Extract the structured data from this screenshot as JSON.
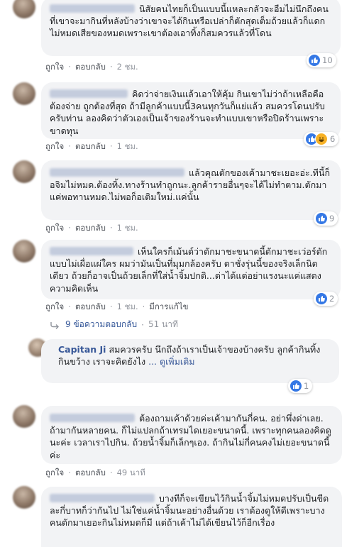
{
  "ui": {
    "like": "ถูกใจ",
    "reply": "ตอบกลับ",
    "dot": "·"
  },
  "comments": [
    {
      "text": "นิสัยคนไทยก็เป็นแบบนี้แหละกลัวจะอืมไม่นึกถึงคนที่เขาจะมากินที่หลังบ้างว่าเขาจะได้กินหรือเปล่าก็ตักสุดเต็มถ้วยแล้วก็แดกไม่หมดเสียของหมดเพราะเขาต้องเอาทิ้งก็สมควรแล้วที่โดน",
      "time": "2 ชม.",
      "reactions": "10"
    },
    {
      "text": "คิดว่าจ่ายเงินแล้วเอาให้คุ้ม กินเขาไม่ว่าถ้าเหลือคือต้องจ่าย ถูกต้องที่สุด ถ้ามีลูกค้าแบบนี้3คนทุกวันก็แย่แล้ว สมควรโดนปรับครับท่าน ลองคิดว่าตัวเองเป็นเจ้าของร้านจะทำแบบเขาหรือปิดร้านเพราะขาดทุน",
      "time": "1 ชม.",
      "reactions": "6"
    },
    {
      "text": "แล้วคุณตักของเค้ามาชะเยอะอ่ะ.ทีนี้ก็อจิมไม่หมด.ต้องทิ้ง.ทางร้านทำถูกนะ.ลูกค้ารายอื่นๆจะได้ไม่ทำตาม.ตักมาแค่พอทานหมด.ไม่พอก็อเติมใหม่.แค่นั้น",
      "time": "1 ชม.",
      "reactions": "9"
    },
    {
      "text": "เห็นใครก็เม้นต์ว่าตักมาชะขนาดนี้ตักมาชะเว่อร์ตักแบบไม่เผื่อแผ่ใคร ผมว่ามันเป็นที่มุมกล้องครับ ตาชั่งรุ่นนี้ของจริงเล็กนิดเดียว ถ้วยก็อาจเป็นถ้วยเล็กที่ใส่น้ำจิ้มปกติ...ด่าได้แต่อย่าแรงนะแค่แสดงความคิดเห็น",
      "time": "1 ชม.",
      "edited": "มีการแก้ไข",
      "reactions": "2"
    },
    {
      "name": "Capitan Ji",
      "text": "สมควรครับ นึกถึงถ้าเราเป็นเจ้าของบ้างครับ ลูกค้ากินทิ้งกินขว้าง เราจะคิดยังไง",
      "more": "... ดูเพิ่มเติม",
      "reactions": "1"
    },
    {
      "text": "ต้องถามเค้าด้วยค่ะเค้ามากันกี่คน. อย่าพึ่งด่าเลย. ถ้ามากันหลายคน. ก็ไม่แปลกถ้าเทรมไดเยอะขนาดนี้. เพราะทุกคนลองคิดดูนะค่ะ เวลาเราไปกิน. ถ้วยน้ำจิ้มก็เล็กๆเอง. ถ้ากินไม่กี่คนคงไม่เยอะขนาดนี้ค่ะ",
      "time": "49 นาที"
    },
    {
      "text": "บางทีก็จะเขียนไว้กินน้ำจิ้มไม่หมดปรับเป็นขีดละกี่บาทก็ว่ากันไป ไม่ใช่แค่น้ำจิ้มนะอย่างอื่นด้วย เราต้องดูให้ดีเพราะบางคนตักมาเยอะกินไม่หมดก็มี แต่ถ้าเค้าไม่ได้เขียนไว้ก็อีกเรื่อง"
    }
  ],
  "replies": {
    "count": "9 ข้อความตอบกลับ",
    "time": "51 นาที"
  },
  "colors": {
    "link": "#385898",
    "like_blue": "#3578e5",
    "haha_yellow": "#f7b125",
    "bubble": "#f2f3f5"
  }
}
